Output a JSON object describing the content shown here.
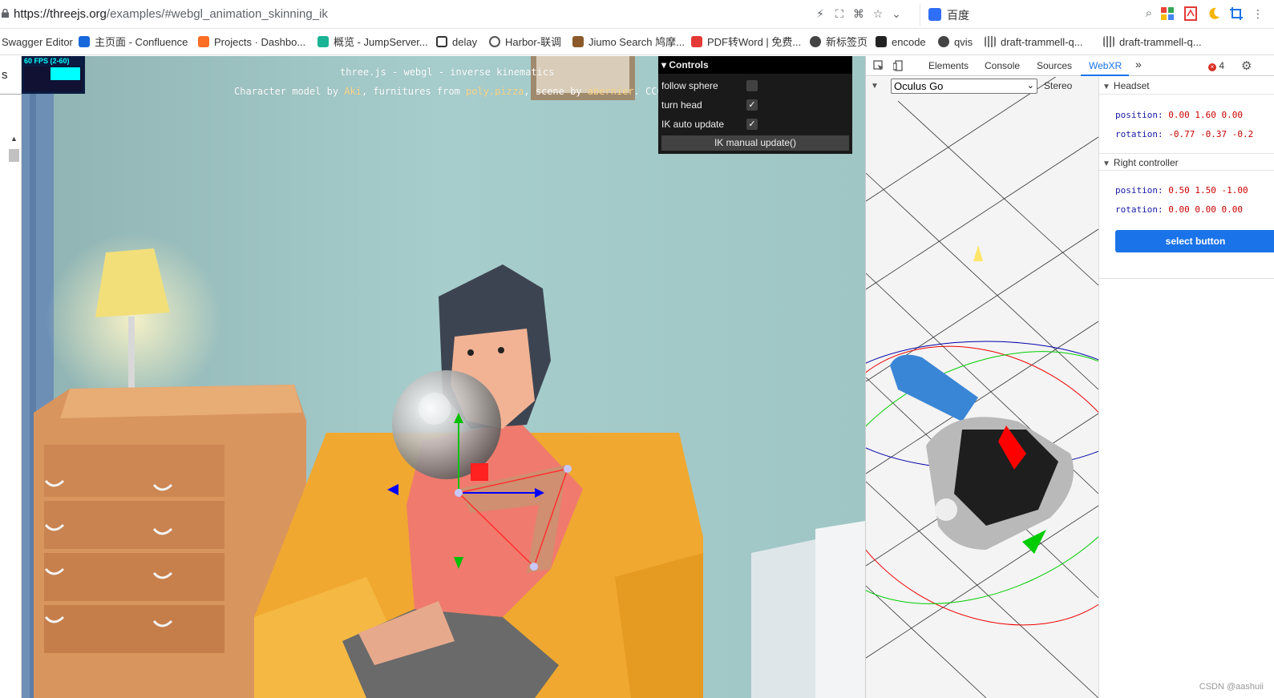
{
  "browser": {
    "url_host": "https://threejs.org",
    "url_path": "/examples/#webgl_animation_skinning_ik",
    "search_engine": "百度"
  },
  "bookmarks": [
    {
      "label": "Swagger Editor",
      "color": "#85ea2d"
    },
    {
      "label": "主页面 - Confluence",
      "color": "#1868db"
    },
    {
      "label": "Projects · Dashbo...",
      "color": "#fc6d26"
    },
    {
      "label": "概览 - JumpServer...",
      "color": "#1ab394"
    },
    {
      "label": "delay",
      "color": "#333333"
    },
    {
      "label": "Harbor-联调",
      "color": "#555555"
    },
    {
      "label": "Jiumo Search 鸠摩...",
      "color": "#8a5a2b"
    },
    {
      "label": "PDF转Word | 免费...",
      "color": "#e53935"
    },
    {
      "label": "新标签页",
      "color": "#444444"
    },
    {
      "label": "encode",
      "color": "#222222"
    },
    {
      "label": "qvis",
      "color": "#444444"
    },
    {
      "label": "draft-trammell-q...",
      "color": "#777777"
    },
    {
      "label": "draft-trammell-q...",
      "color": "#777777"
    }
  ],
  "left_sliver": {
    "text": "s"
  },
  "scene": {
    "fps_label": "60 FPS (2-60)",
    "title_line": "three.js - webgl - inverse kinematics",
    "credit_parts": {
      "p1": "Character model by ",
      "p2": "Aki",
      "p3": ", furnitures from ",
      "p4": "poly.pizza",
      "p5": ", scene by ",
      "p6": "abernier",
      "p7": ". CC0."
    }
  },
  "controls": {
    "header": "Controls",
    "rows": [
      {
        "label": "follow sphere",
        "checked": false,
        "mark": ""
      },
      {
        "label": "turn head",
        "checked": true,
        "mark": "✓"
      },
      {
        "label": "IK auto update",
        "checked": true,
        "mark": "✓"
      }
    ],
    "button": "IK manual update()"
  },
  "devtools": {
    "tabs": [
      "Elements",
      "Console",
      "Sources",
      "WebXR"
    ],
    "active_tab": "WebXR",
    "more": "»",
    "error_count": "4",
    "device": "Oculus Go",
    "stereo_label": "Stereo",
    "headset": {
      "title": "Headset",
      "position_label": "position:",
      "position_value": "0.00  1.60  0.00",
      "rotation_label": "rotation:",
      "rotation_value": "-0.77  -0.37  -0.2"
    },
    "right_controller": {
      "title": "Right controller",
      "position_label": "position:",
      "position_value": "0.50  1.50  -1.00",
      "rotation_label": "rotation:",
      "rotation_value": "0.00  0.00  0.00"
    },
    "select_button": "select button"
  },
  "watermark": "CSDN @aashuii"
}
